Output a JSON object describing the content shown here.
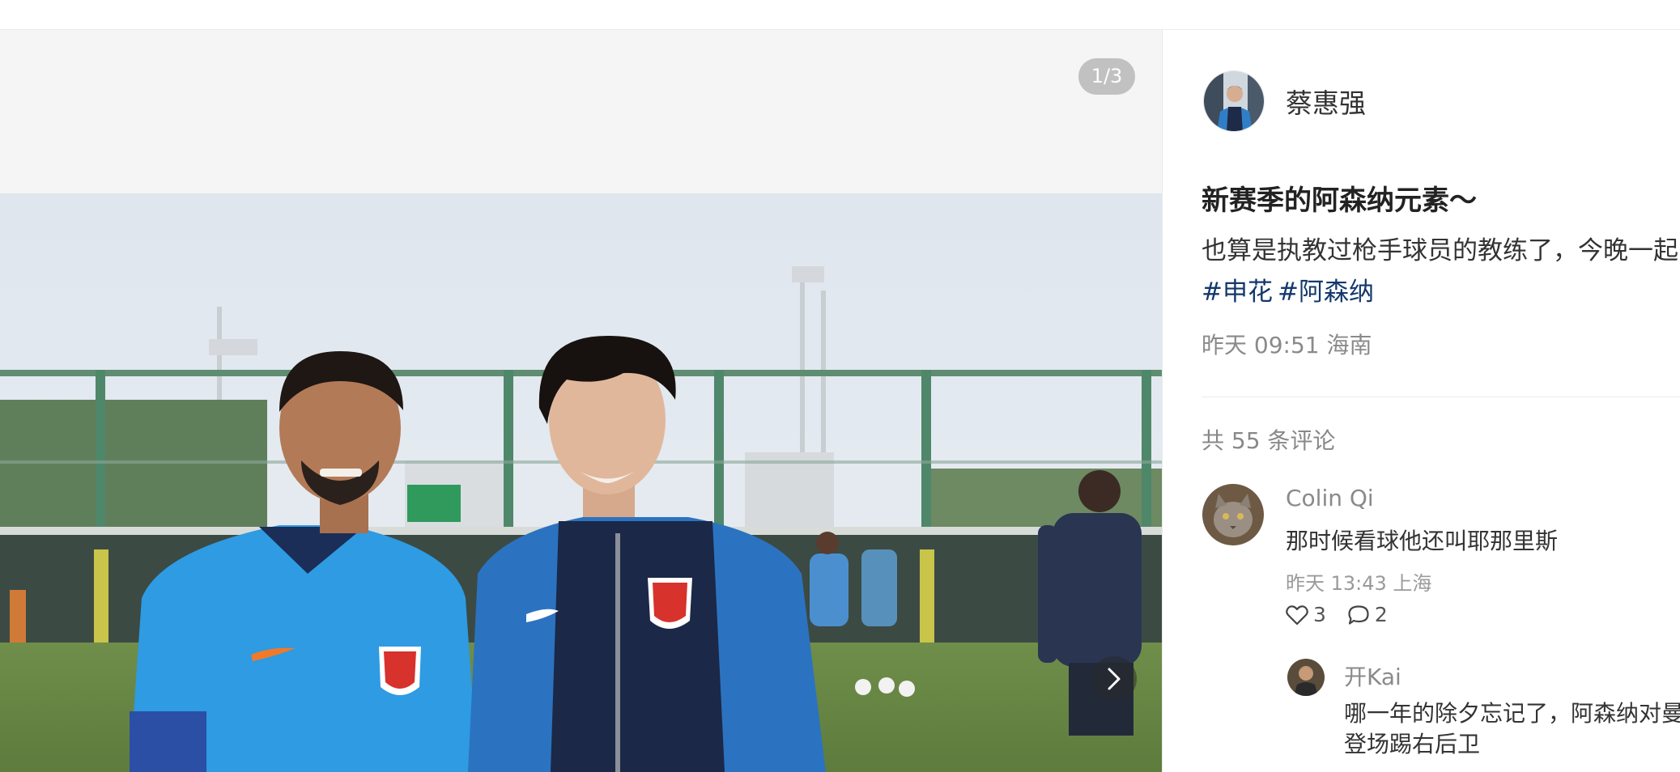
{
  "gallery": {
    "counter": "1/3"
  },
  "author": {
    "name": "蔡惠强"
  },
  "post": {
    "title": "新赛季的阿森纳元素～",
    "body": "也算是执教过枪手球员的教练了，今晚一起",
    "tags": [
      "#申花",
      "#阿森纳"
    ],
    "meta": "昨天 09:51 海南"
  },
  "comments": {
    "count_label": "共 55 条评论",
    "items": [
      {
        "name": "Colin Qi",
        "text": "那时候看球他还叫耶那里斯",
        "meta": "昨天 13:43 上海",
        "likes": "3",
        "replies": "2"
      }
    ],
    "reply": {
      "name": "开Kai",
      "text_line1": "哪一年的除夕忘记了，阿森纳对曼",
      "text_line2": "登场踢右后卫"
    }
  }
}
